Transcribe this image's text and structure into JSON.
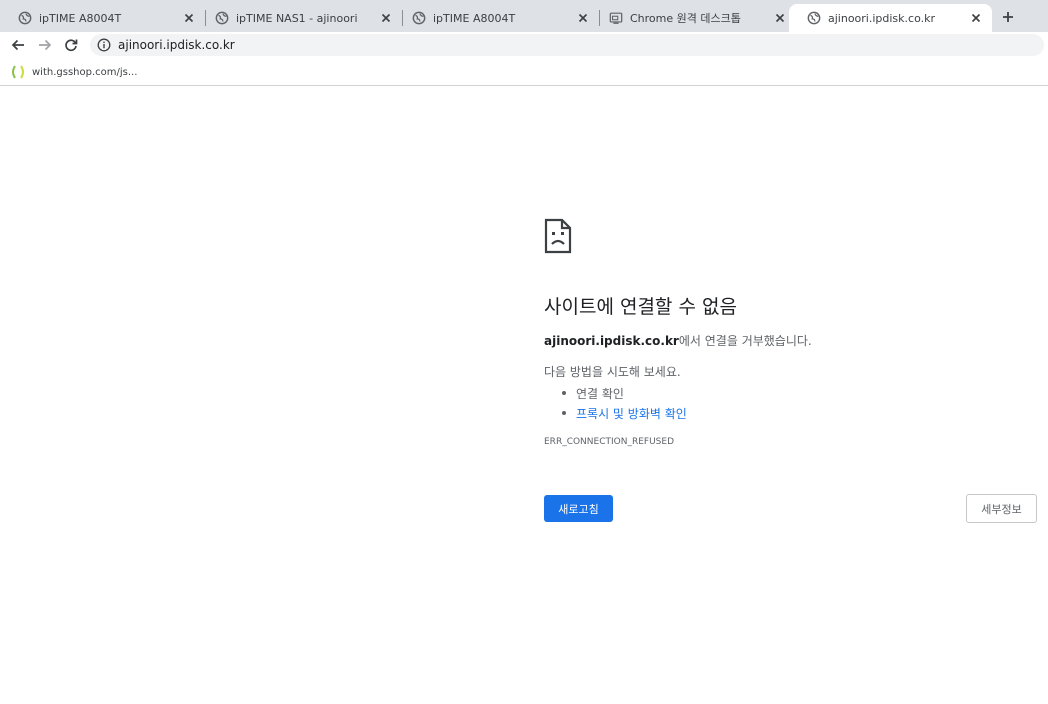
{
  "tabs": [
    {
      "title": "ipTIME A8004T",
      "icon": "globe-icon",
      "active": false
    },
    {
      "title": "ipTIME NAS1 - ajinoori",
      "icon": "globe-icon",
      "active": false
    },
    {
      "title": "ipTIME A8004T",
      "icon": "globe-icon",
      "active": false
    },
    {
      "title": "Chrome 원격 데스크톱",
      "icon": "remote-desktop-icon",
      "active": false
    },
    {
      "title": "ajinoori.ipdisk.co.kr",
      "icon": "globe-icon",
      "active": true
    }
  ],
  "toolbar": {
    "url": "ajinoori.ipdisk.co.kr"
  },
  "bookmarks": [
    {
      "label": "with.gsshop.com/js..."
    }
  ],
  "error": {
    "title": "사이트에 연결할 수 없음",
    "host": "ajinoori.ipdisk.co.kr",
    "desc_suffix": "에서 연결을 거부했습니다.",
    "suggest_heading": "다음 방법을 시도해 보세요.",
    "suggestions": [
      {
        "text": "연결 확인",
        "link": false
      },
      {
        "text": "프록시 및 방화벽 확인",
        "link": true
      }
    ],
    "code": "ERR_CONNECTION_REFUSED",
    "reload_label": "새로고침",
    "details_label": "세부정보"
  },
  "colors": {
    "tabstrip": "#dee1e6",
    "accent": "#1a73e8",
    "text_secondary": "#5f6368"
  }
}
